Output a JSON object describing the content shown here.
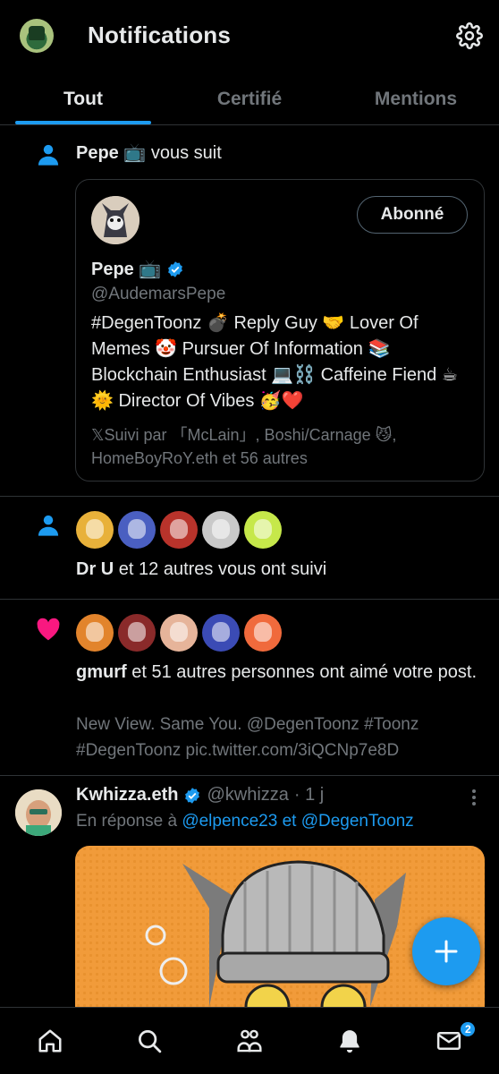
{
  "header": {
    "title": "Notifications"
  },
  "tabs": [
    {
      "label": "Tout",
      "active": true
    },
    {
      "label": "Certifié",
      "active": false
    },
    {
      "label": "Mentions",
      "active": false
    }
  ],
  "follow_notif": {
    "actor": "Pepe 📺",
    "action": " vous suit",
    "card": {
      "name": "Pepe 📺",
      "handle": "@AudemarsPepe",
      "button": "Abonné",
      "bio": "#DegenToonz 💣 Reply Guy 🤝 Lover Of Memes 🤡 Pursuer Of Information 📚 Blockchain Enthusiast 💻⛓️ Caffeine Fiend ☕🌞 Director Of Vibes 🥳❤️",
      "followed_by": "𝕏Suivi par 「McLain」, Boshi/Carnage 😼, HomeBoyRoY.eth et 56 autres"
    }
  },
  "group_follow": {
    "actor": "Dr U",
    "rest": " et 12 autres vous ont suivi",
    "avatar_colors": [
      "#e8b13a",
      "#4a5fc1",
      "#b8332b",
      "#c9c9c9",
      "#c6e84a"
    ]
  },
  "likes": {
    "actor": "gmurf",
    "rest": " et 51 autres personnes ont aimé votre post.",
    "post_preview": "New View. Same You. @DegenToonz #Toonz #DegenToonz pic.twitter.com/3iQCNp7e8D",
    "avatar_colors": [
      "#e2842c",
      "#8a2a2a",
      "#e6b49a",
      "#3b4bb5",
      "#f06a3c"
    ]
  },
  "tweet": {
    "name": "Kwhizza.eth",
    "handle": "@kwhizza",
    "time": "· 1 j",
    "reply_prefix": "En réponse à ",
    "reply_targets": "@elpence23 et @DegenToonz"
  },
  "bottom_nav": {
    "messages_badge": "2"
  },
  "colors": {
    "accent": "#1d9bf0",
    "like": "#f91880",
    "bg": "#000000",
    "border": "#2f3336",
    "muted": "#71767b"
  }
}
